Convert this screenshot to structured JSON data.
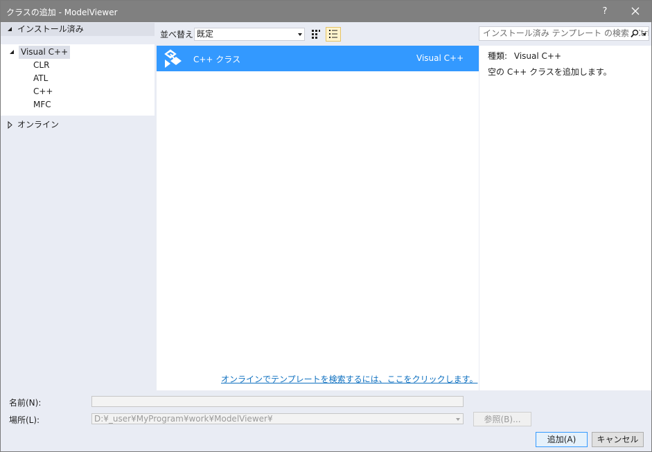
{
  "window": {
    "title": "クラスの追加 - ModelViewer",
    "help": "?"
  },
  "tree": {
    "installed": "インストール済み",
    "visual_cpp": "Visual C++",
    "children": [
      "CLR",
      "ATL",
      "C++",
      "MFC"
    ],
    "online": "オンライン"
  },
  "toolbar": {
    "sort_label": "並べ替え:",
    "sort_value": "既定",
    "search_placeholder": "インストール済み テンプレート の検索 (Ctrl+E)"
  },
  "templates": [
    {
      "name": "C++ クラス",
      "language": "Visual C++"
    }
  ],
  "online_link": "オンラインでテンプレートを検索するには、ここをクリックします。",
  "details": {
    "type_label": "種類:",
    "type_value": "Visual C++",
    "description": "空の C++ クラスを追加します。"
  },
  "form": {
    "name_label": "名前(N):",
    "name_value": "",
    "location_label": "場所(L):",
    "location_value": "D:¥_user¥MyProgram¥work¥ModelViewer¥",
    "browse_label": "参照(B)...",
    "add_label": "追加(A)",
    "cancel_label": "キャンセル"
  },
  "colors": {
    "selection": "#3399ff",
    "titlebar": "#808080",
    "link": "#0e70c0"
  }
}
